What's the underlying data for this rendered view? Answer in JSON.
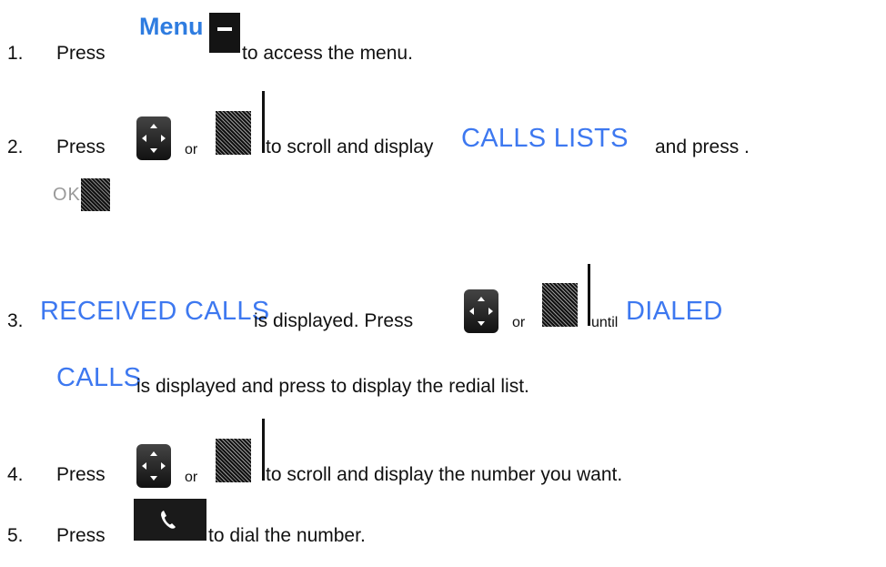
{
  "steps": [
    {
      "num": "1.",
      "press": "Press",
      "menu_word": "Menu",
      "text": "to access the menu."
    },
    {
      "num": "2.",
      "press": "Press",
      "or": "or",
      "text_a": "to scroll and display",
      "highlight": "CALLS LISTS",
      "text_b": "and press .",
      "ok_text": "OK"
    },
    {
      "num": "3.",
      "highlight_a": "RECEIVED CALLS",
      "text_a": "is displayed.  Press",
      "or": "or",
      "until": "until",
      "highlight_b1": "DIALED",
      "highlight_b2": "CALLS",
      "text_b": "is displayed and press to display the redial list."
    },
    {
      "num": "4.",
      "press": "Press",
      "or": "or",
      "text": "to scroll and display the number you want."
    },
    {
      "num": "5.",
      "press": "Press",
      "text": "to dial the number."
    }
  ],
  "icons": {
    "nav_key": "navigation-key-icon",
    "nav_key_dithered": "navigation-key-dithered-icon",
    "soft_key": "soft-key-icon",
    "call_key": "call-key-icon",
    "phone": "phone-handset-icon"
  }
}
